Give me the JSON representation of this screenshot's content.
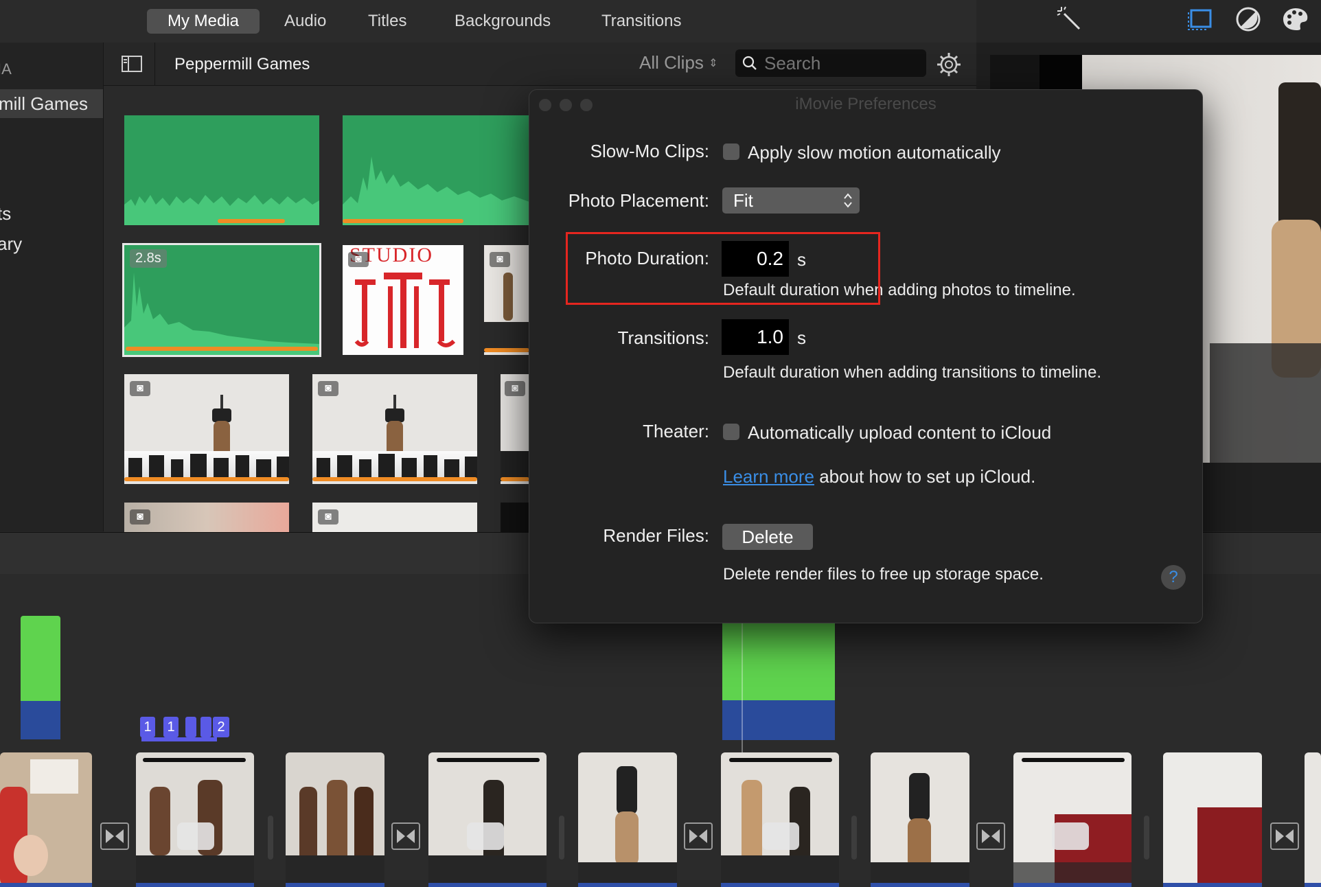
{
  "media_tabs": [
    {
      "label": "My Media"
    },
    {
      "label": "Audio"
    },
    {
      "label": "Titles"
    },
    {
      "label": "Backgrounds"
    },
    {
      "label": "Transitions"
    }
  ],
  "sidebar": {
    "items": [
      {
        "label": "IA"
      },
      {
        "label": "mill Games"
      },
      {
        "label": "ts"
      },
      {
        "label": "ary"
      }
    ]
  },
  "browser": {
    "title": "Peppermill Games",
    "filter": "All Clips",
    "search_placeholder": "Search",
    "selected_clip_duration": "2.8s",
    "studio_logo_text": "STUDIO"
  },
  "prefs": {
    "title": "iMovie Preferences",
    "slowmo_label": "Slow-Mo Clips:",
    "slowmo_option": "Apply slow motion automatically",
    "photo_placement_label": "Photo Placement:",
    "photo_placement_value": "Fit",
    "photo_duration_label": "Photo Duration:",
    "photo_duration_value": "0.2",
    "photo_duration_unit": "s",
    "photo_duration_help": "Default duration when adding photos to timeline.",
    "transitions_label": "Transitions:",
    "transitions_value": "1.0",
    "transitions_unit": "s",
    "transitions_help": "Default duration when adding transitions to timeline.",
    "theater_label": "Theater:",
    "theater_option": "Automatically upload content to iCloud",
    "learn_more_link": "Learn more",
    "learn_more_rest": "about how to set up iCloud.",
    "render_files_label": "Render Files:",
    "delete_button": "Delete",
    "render_help": "Delete render files to free up storage space.",
    "help_glyph": "?"
  },
  "timeline": {
    "markers": [
      "1",
      "1",
      "",
      "",
      "2"
    ]
  },
  "colors": {
    "accent_blue": "#3a8ee6",
    "audio_green": "#2e9e5c",
    "highlight_red": "#e5261f",
    "orange_range": "#f08c24",
    "timeline_blue": "#2f4fa8"
  }
}
